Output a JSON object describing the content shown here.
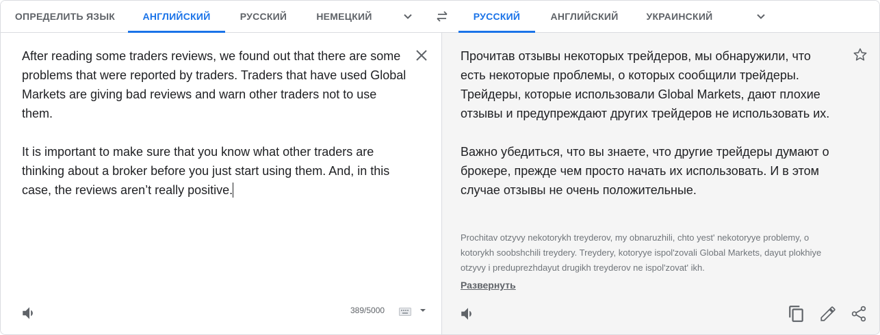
{
  "source_languages": {
    "tabs": [
      {
        "label": "ОПРЕДЕЛИТЬ ЯЗЫК",
        "active": false
      },
      {
        "label": "АНГЛИЙСКИЙ",
        "active": true
      },
      {
        "label": "РУССКИЙ",
        "active": false
      },
      {
        "label": "НЕМЕЦКИЙ",
        "active": false
      }
    ],
    "more_icon": "chevron-down-icon"
  },
  "swap_icon": "swap-icon",
  "target_languages": {
    "tabs": [
      {
        "label": "РУССКИЙ",
        "active": true
      },
      {
        "label": "АНГЛИЙСКИЙ",
        "active": false
      },
      {
        "label": "УКРАИНСКИЙ",
        "active": false
      }
    ],
    "more_icon": "chevron-down-icon"
  },
  "source": {
    "text": "After reading some traders reviews, we found out that there are some problems that were reported by traders. Traders that have used Global Markets are giving bad reviews and warn other traders not to use them.\n\nIt is important to make sure that you know what other traders are thinking about a broker before you just start using them. And, in this case, the reviews aren’t really positive.",
    "char_count": "389/5000",
    "icons": [
      "close-icon",
      "speaker-icon",
      "keyboard-icon",
      "dropdown-caret-icon"
    ]
  },
  "target": {
    "text": "Прочитав отзывы некоторых трейдеров, мы обнаружили, что есть некоторые проблемы, о которых сообщили трейдеры. Трейдеры, которые использовали Global Markets, дают плохие отзывы и предупреждают других трейдеров не использовать их.\n\nВажно убедиться, что вы знаете, что другие трейдеры думают о брокере, прежде чем просто начать их использовать. И в этом случае отзывы не очень положительные.",
    "transliteration": "Prochitav otzyvy nekotorykh treyderov, my obnaruzhili, chto yest' nekotoryye problemy, o kotorykh soobshchili treydery. Treydery, kotoryye ispol'zovali Global Markets, dayut plokhiye otzyvy i preduprezhdayut drugikh treyderov ne ispol'zovat' ikh.",
    "expand_label": "Развернуть",
    "icons": [
      "star-icon",
      "speaker-icon",
      "copy-icon",
      "edit-icon",
      "share-icon"
    ]
  },
  "colors": {
    "accent": "#1a73e8",
    "tab_inactive": "#5f6368",
    "target_bg": "#f5f5f5",
    "border": "#dadce0"
  }
}
